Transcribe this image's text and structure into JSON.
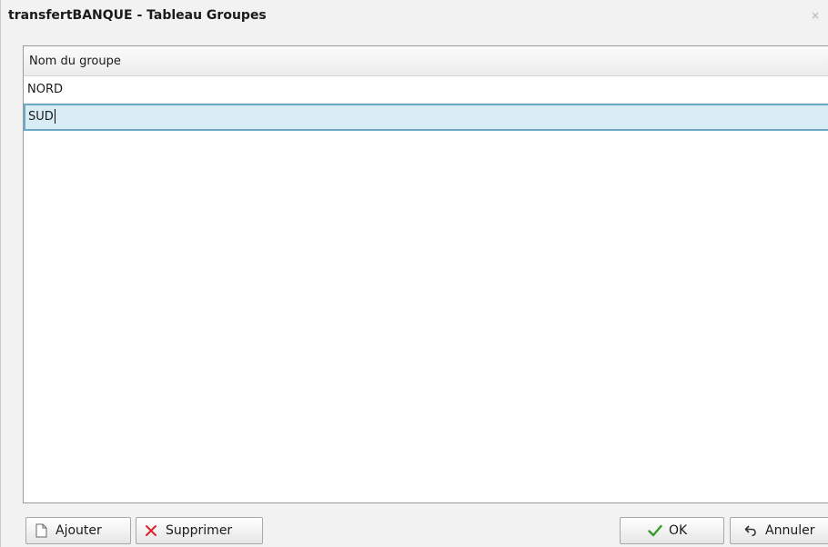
{
  "window": {
    "title": "transfertBANQUE - Tableau Groupes",
    "close_glyph": "×"
  },
  "grid": {
    "column_header": "Nom du groupe",
    "rows": [
      {
        "value": "NORD"
      },
      {
        "value": "SUD"
      }
    ]
  },
  "buttons": {
    "add_label": "Ajouter",
    "delete_label": "Supprimer",
    "ok_label": "OK",
    "cancel_label": "Annuler"
  },
  "icons": {
    "add": "new-document-icon",
    "delete": "red-x-icon",
    "ok": "green-checkmark-icon",
    "cancel": "undo-arrow-icon"
  },
  "colors": {
    "selected_row_bg": "#d8ecf4",
    "selected_row_border": "#6ba9c4",
    "delete_icon": "#d9262c",
    "ok_icon": "#3a9a2c"
  }
}
